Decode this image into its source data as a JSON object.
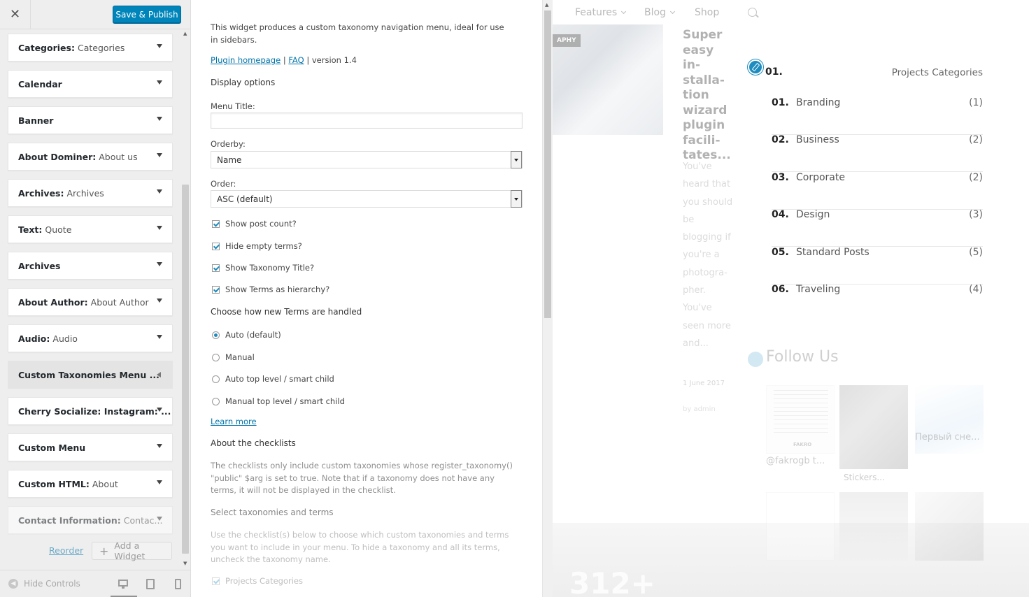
{
  "sidebar": {
    "close_label": "✕",
    "publish_label": "Save & Publish",
    "widgets": [
      {
        "title": "Categories:",
        "sub": "Categories"
      },
      {
        "title": "Calendar",
        "sub": ""
      },
      {
        "title": "Banner",
        "sub": ""
      },
      {
        "title": "About Dominer:",
        "sub": "About us"
      },
      {
        "title": "Archives:",
        "sub": "Archives"
      },
      {
        "title": "Text:",
        "sub": "Quote"
      },
      {
        "title": "Archives",
        "sub": ""
      },
      {
        "title": "About Author:",
        "sub": "About Author"
      },
      {
        "title": "Audio:",
        "sub": "Audio"
      },
      {
        "title": "Custom Taxonomies Menu ...",
        "sub": ""
      },
      {
        "title": "Cherry Socialize: Instagram: ...",
        "sub": ""
      },
      {
        "title": "Custom Menu",
        "sub": ""
      },
      {
        "title": "Custom HTML:",
        "sub": "About"
      },
      {
        "title": "Contact Information:",
        "sub": "Contac..."
      }
    ],
    "reorder_label": "Reorder",
    "add_widget_label": "Add a Widget",
    "hide_controls_label": "Hide Controls",
    "devices": [
      "desktop-icon",
      "tablet-icon",
      "mobile-icon"
    ]
  },
  "form": {
    "intro": "This widget produces a custom taxonomy navigation menu, ideal for use in sidebars.",
    "plugin_link": "Plugin homepage",
    "sep1": "|",
    "faq_link": "FAQ",
    "version": "| version 1.4",
    "display_options": "Display options",
    "menu_title_label": "Menu Title:",
    "menu_title_value": "",
    "orderby_label": "Orderby:",
    "orderby_value": "Name",
    "order_label": "Order:",
    "order_value": "ASC (default)",
    "checkboxes": [
      {
        "label": "Show post count?",
        "checked": true
      },
      {
        "label": "Hide empty terms?",
        "checked": true
      },
      {
        "label": "Show Taxonomy Title?",
        "checked": true
      },
      {
        "label": "Show Terms as hierarchy?",
        "checked": true
      }
    ],
    "terms_heading": "Choose how new Terms are handled",
    "radios": [
      {
        "label": "Auto (default)",
        "checked": true
      },
      {
        "label": "Manual",
        "checked": false
      },
      {
        "label": "Auto top level / smart child",
        "checked": false
      },
      {
        "label": "Manual top level / smart child",
        "checked": false
      }
    ],
    "learn_more": "Learn more",
    "checklists_heading": "About the checklists",
    "checklists_text": "The checklists only include custom taxonomies whose register_taxonomy() \"public\" $arg is set to true. Note that if a taxonomy does not have any terms, it will not be displayed in the checklist.",
    "select_heading": "Select taxonomies and terms",
    "select_text": "Use the checklist(s) below to choose which custom taxonomies and terms you want to include in your menu. To hide a taxonomy and all its terms, uncheck the taxonomy name.",
    "projects_categories_label": "Projects Categories"
  },
  "preview": {
    "nav": [
      "Features",
      "Blog",
      "Shop"
    ],
    "post": {
      "image_tag": "APHY",
      "title": "Super easy in­stalla­tion wizard plugin facili­tates...",
      "excerpt": "You've heard that you should be blogging if you're a photogra­pher. You've seen more and...",
      "date": "1 June 2017",
      "author": "by admin"
    },
    "categories_widget": {
      "head_num": "01.",
      "title": "Projects Categories",
      "items": [
        {
          "num": "01.",
          "name": "Branding",
          "count": "(1)"
        },
        {
          "num": "02.",
          "name": "Business",
          "count": "(2)"
        },
        {
          "num": "03.",
          "name": "Corporate",
          "count": "(2)"
        },
        {
          "num": "04.",
          "name": "Design",
          "count": "(3)"
        },
        {
          "num": "05.",
          "name": "Standard Posts",
          "count": "(5)"
        },
        {
          "num": "06.",
          "name": "Traveling",
          "count": "(4)"
        }
      ]
    },
    "follow_title": "Follow Us",
    "instagram": {
      "captions": [
        "@fakrogb t...",
        "Первый сне...",
        "Stickers..."
      ],
      "brand": "FAKRO"
    },
    "counter": "312+"
  },
  "colors": {
    "accent": "#0085ba",
    "link": "#0073aa",
    "edit_icon": "#1e8cbe"
  }
}
